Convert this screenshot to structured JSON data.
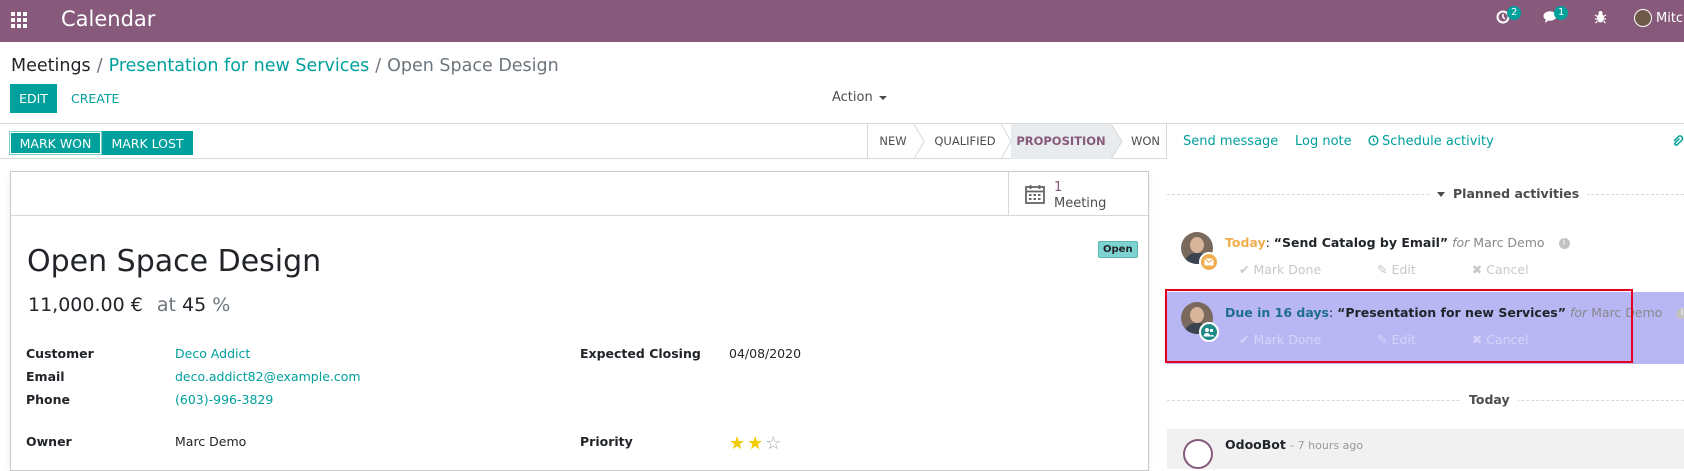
{
  "navbar": {
    "app_title": "Calendar",
    "activities_count": "2",
    "messages_count": "1",
    "user_name": "Mitchell Admin",
    "bg_color": "#875a7b"
  },
  "breadcrumb": {
    "root": "Meetings",
    "middle": "Presentation for new Services",
    "current": "Open Space Design"
  },
  "toolbar": {
    "edit_label": "EDIT",
    "create_label": "CREATE",
    "action_label": "Action"
  },
  "statusbar": {
    "mark_won_label": "MARK WON",
    "mark_lost_label": "MARK LOST",
    "stages": [
      "NEW",
      "QUALIFIED",
      "PROPOSITION",
      "WON"
    ],
    "active_stage": "PROPOSITION"
  },
  "smart_button": {
    "value": "1",
    "label": "Meeting"
  },
  "record": {
    "ribbon": "Open",
    "title": "Open Space Design",
    "revenue": "11,000.00 €",
    "at_label": "at",
    "probability": "45",
    "percent_sign": "%",
    "fields": {
      "customer_label": "Customer",
      "customer_value": "Deco Addict",
      "email_label": "Email",
      "email_value": "deco.addict82@example.com",
      "phone_label": "Phone",
      "phone_value": "(603)-996-3829",
      "owner_label": "Owner",
      "owner_value": "Marc Demo",
      "expected_closing_label": "Expected Closing",
      "expected_closing_value": "04/08/2020",
      "priority_label": "Priority",
      "priority_stars": 2,
      "priority_max": 3
    }
  },
  "chatter": {
    "send_message": "Send message",
    "log_note": "Log note",
    "schedule_activity": "Schedule activity",
    "planned_label": "Planned activities",
    "today_separator": "Today",
    "activities": [
      {
        "when": "Today",
        "when_color": "#f0ad4e",
        "summary": "“Send Catalog by Email”",
        "for_label": "for",
        "user": "Marc Demo",
        "badge_color": "#f0ad4e",
        "badge_icon": "envelope-icon"
      },
      {
        "when": "Due in 16 days",
        "when_color": "#1f6f8b",
        "summary": "“Presentation for new Services”",
        "for_label": "for",
        "user": "Marc Demo",
        "badge_color": "#1f8a85",
        "badge_icon": "users-icon"
      }
    ],
    "action_labels": {
      "mark_done": "Mark Done",
      "edit": "Edit",
      "cancel": "Cancel"
    },
    "message": {
      "author": "OdooBot",
      "time": "7 hours ago"
    }
  }
}
